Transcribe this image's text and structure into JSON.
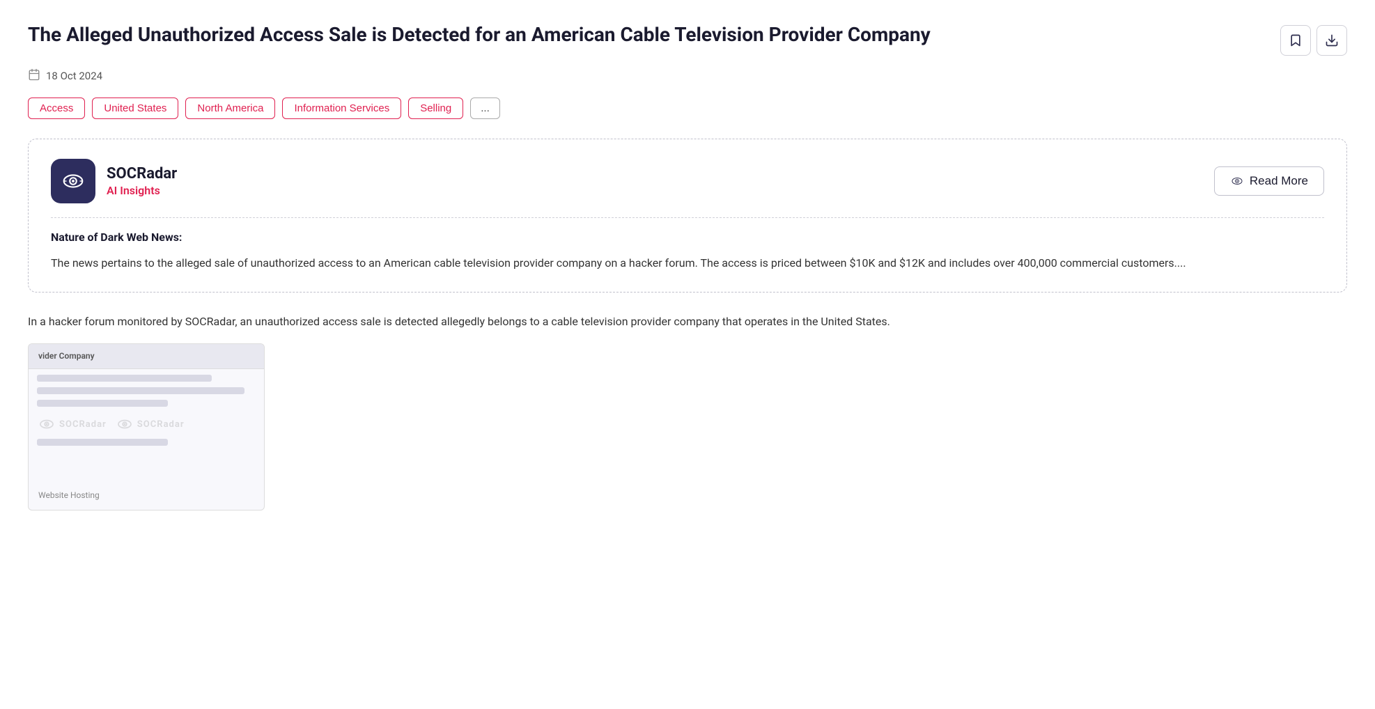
{
  "header": {
    "title": "The Alleged Unauthorized Access Sale is Detected for an American Cable Television Provider Company",
    "date": "18 Oct 2024",
    "bookmark_label": "bookmark",
    "download_label": "download"
  },
  "tags": [
    {
      "label": "Access",
      "type": "red"
    },
    {
      "label": "United States",
      "type": "red"
    },
    {
      "label": "North America",
      "type": "red"
    },
    {
      "label": "Information Services",
      "type": "red"
    },
    {
      "label": "Selling",
      "type": "red"
    },
    {
      "label": "...",
      "type": "more"
    }
  ],
  "ai_insights": {
    "brand_name": "SOCRadar",
    "brand_sub": "AI Insights",
    "read_more_label": "Read More",
    "nature_label": "Nature of Dark Web News:",
    "nature_text": "The news pertains to the alleged sale of unauthorized access to an American cable television provider company on a hacker forum. The access is priced between $10K and $12K and includes over 400,000 commercial customers...."
  },
  "article_body": "In a hacker forum monitored by SOCRadar, an unauthorized access sale is detected allegedly belongs to a cable television provider company that operates in the United States.",
  "screenshot": {
    "label": "Website Hosting",
    "bar_label": "vider Company"
  }
}
